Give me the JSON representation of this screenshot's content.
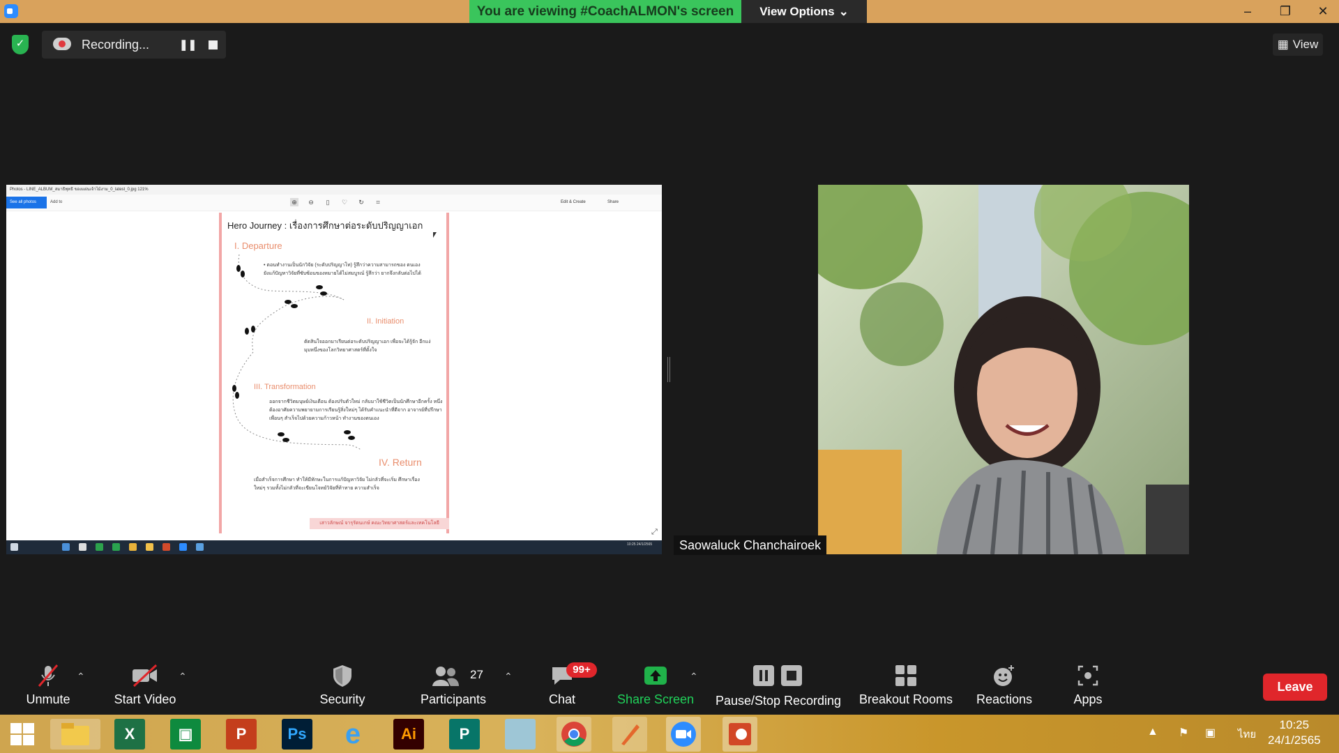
{
  "window": {
    "viewing_banner": "You are viewing #CoachALMON's screen",
    "view_options": "View Options",
    "minimize": "–",
    "maximize": "❐",
    "close": "✕"
  },
  "recording": {
    "label": "Recording...",
    "pause_glyph": "❚❚"
  },
  "view_button": "View",
  "shared_screen": {
    "photos_title": "Photos - LINE_ALBUM_สมาธิพุทธิ ของแผ่นเจ้าไม้งาม_0_latest_0.jpg   121%",
    "see_all": "See all photos",
    "add_to": "Add to",
    "edit_create": "Edit & Create",
    "share": "Share",
    "doc_title": "Hero Journey : เรื่องการศึกษาต่อระดับปริญญาเอก",
    "section_1": "I.  Departure",
    "section_1_text": "• ตอนทำงานเป็นนักวิจัย (ระดับปริญญาโท) รู้สึกว่าความสามารถของ ตนเองยังแก้ปัญหาวิจัยที่ซับซ้อนของหมายได้ไม่สมบูรณ์ รู้สึกว่า ยากจึงกลับต่อไปได้",
    "section_2": "II.  Initiation",
    "section_2_text": "ตัดสินใจออกมาเรียนต่อระดับปริญญาเอก เพื่อจะได้รู้จัก อีกแง่มุมหนึ่งของโลกวิทยาศาสตร์ที่ตั้งใจ",
    "section_3": "III.  Transformation",
    "section_3_text": "ออกจากชีวิตมนุษย์เงินเดือน ต้องปรับตัวใหม่ กลับมาใช้ชีวิตเป็นนักศึกษาอีกครั้ง หนึ่ง ต้องอาศัยความพยายามการเรียนรู้สิ่งใหม่ๆ ได้รับคำแนะนำที่ดีจาก อาจารย์ที่ปรึกษา เพื่อนๆ สำเร็จไปด้วยความก้าวหน้า ทำงานของตนเอง",
    "section_4": "IV.  Return",
    "section_4_text": "เมื่อสำเร็จการศึกษา ทำให้มีทักษะในการแก้ปัญหาวิจัย ไม่กลัวที่จะเริ่ม ศึกษาเรื่องใหม่ๆ รวมทั้งไม่กลัวที่จะเขียนโจทย์วิจัยที่ท้าทาย ความสำเร็จ",
    "doc_footer": "เสาวลักษณ์ จารุรัตนเกษ์ คณะวิทยาศาสตร์และเทคโนโลยี",
    "taskbar_time": "10:25\n24/1/2565"
  },
  "participant": {
    "name": "Saowaluck Chanchairoek"
  },
  "toolbar": {
    "unmute": "Unmute",
    "start_video": "Start Video",
    "security": "Security",
    "participants": "Participants",
    "participants_count": "27",
    "chat": "Chat",
    "chat_badge": "99+",
    "share_screen": "Share Screen",
    "pause_stop_recording": "Pause/Stop Recording",
    "breakout_rooms": "Breakout Rooms",
    "reactions": "Reactions",
    "apps": "Apps",
    "leave": "Leave"
  },
  "taskbar": {
    "excel": "X",
    "photoshop": "Ps",
    "illustrator": "Ai",
    "publisher": "P",
    "powerpoint": "P",
    "language": "ไทย",
    "time": "10:25",
    "date": "24/1/2565"
  },
  "colors": {
    "banner_green": "#3ac55c",
    "leave_red": "#e0262b",
    "share_green": "#20b24a"
  }
}
